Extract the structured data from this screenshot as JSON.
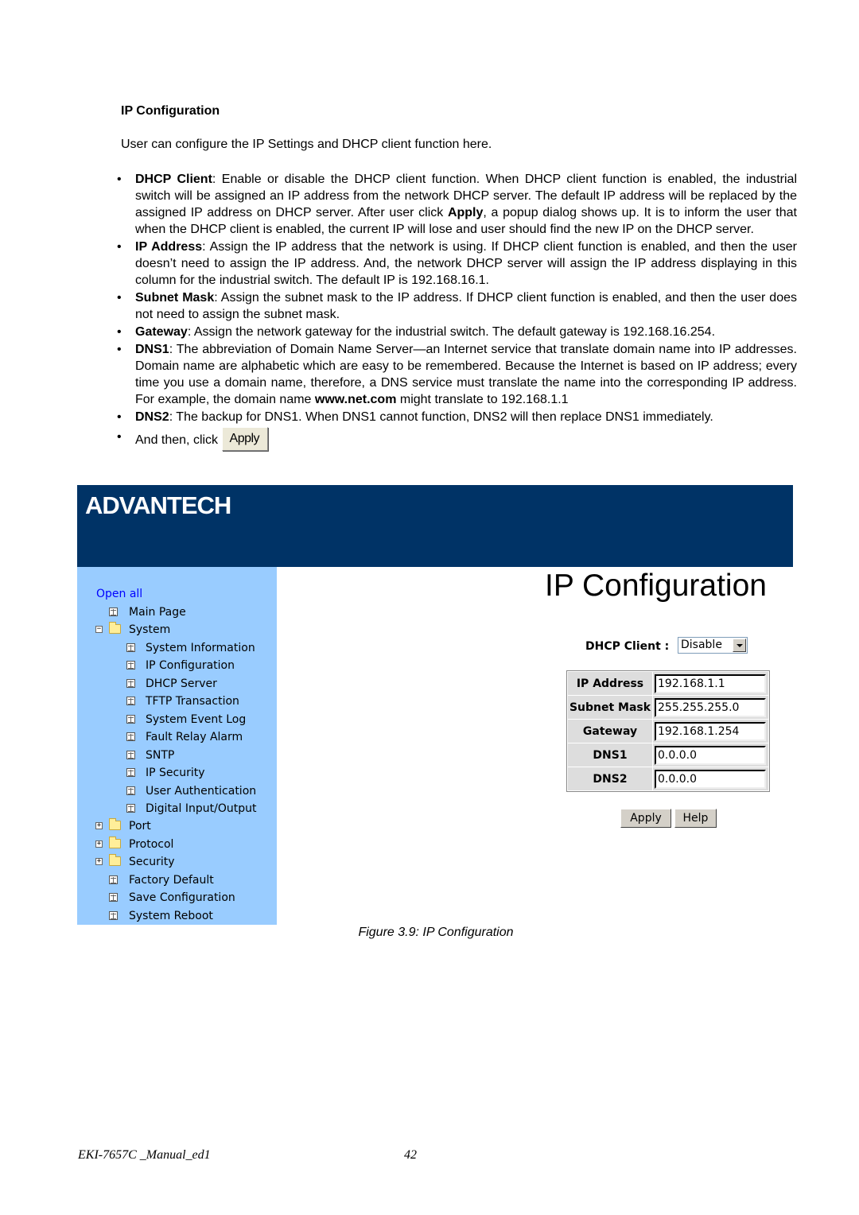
{
  "document": {
    "section_title": "IP Configuration",
    "intro": "User can configure the IP Settings and DHCP client function here.",
    "bullets": [
      {
        "term": "DHCP Client",
        "text_before": ": Enable or disable the DHCP client function. When DHCP client function is enabled, the industrial switch will be assigned an IP address from the network DHCP server. The default IP address will be replaced by the assigned IP address on DHCP server. After user click ",
        "emph": "Apply",
        "text_after": ", a popup dialog shows up. It is to inform the user that when the DHCP client is enabled, the current IP will lose and user should find the new IP on the DHCP server."
      },
      {
        "term": "IP Address",
        "text": ": Assign the IP address that the network is using. If DHCP client function is enabled, and then the user doesn’t need to assign the IP address. And, the network DHCP server will assign the IP address displaying in this column for the industrial switch. The default IP is 192.168.16.1."
      },
      {
        "term": "Subnet Mask",
        "text": ": Assign the subnet mask to the IP address. If DHCP client function is enabled, and then the user does not need to assign the subnet mask."
      },
      {
        "term": "Gateway",
        "text": ": Assign the network gateway for the industrial switch. The default gateway is 192.168.16.254."
      },
      {
        "term": "DNS1",
        "text_before": ": The abbreviation of Domain Name Server—an Internet service that translate domain name into IP addresses. Domain name are alphabetic which are easy to be remembered. Because the Internet is based on IP address; every time you use a domain name, therefore, a DNS service must translate the name into the corresponding IP address. For example, the domain name ",
        "emph": "www.net.com",
        "text_after": " might translate to 192.168.1.1"
      },
      {
        "term": "DNS2",
        "text": ": The backup for DNS1. When DNS1 cannot function, DNS2 will then replace DNS1 immediately."
      }
    ],
    "last_bullet_text": "And then, click",
    "inline_apply_label": "Apply",
    "bullet_glyph": "•",
    "caption": "Figure 3.9: IP Configuration",
    "footer_doc": "EKI-7657C _Manual_ed1",
    "footer_page": "42"
  },
  "screenshot": {
    "logo": "ADVANTECH",
    "colors": {
      "banner": "#003366",
      "sidebar": "#99ccff",
      "open_all_link": "#0000ff"
    },
    "sidebar": {
      "open_all": "Open all",
      "items": [
        {
          "label": "Main Page",
          "type": "page",
          "level": 0
        },
        {
          "label": "System",
          "type": "folder-open",
          "level": 0
        },
        {
          "label": "System Information",
          "type": "page",
          "level": 1
        },
        {
          "label": "IP Configuration",
          "type": "page",
          "level": 1
        },
        {
          "label": "DHCP Server",
          "type": "page",
          "level": 1
        },
        {
          "label": "TFTP Transaction",
          "type": "page",
          "level": 1
        },
        {
          "label": "System Event Log",
          "type": "page",
          "level": 1
        },
        {
          "label": "Fault Relay Alarm",
          "type": "page",
          "level": 1
        },
        {
          "label": "SNTP",
          "type": "page",
          "level": 1
        },
        {
          "label": "IP Security",
          "type": "page",
          "level": 1
        },
        {
          "label": "User Authentication",
          "type": "page",
          "level": 1
        },
        {
          "label": "Digital Input/Output",
          "type": "page",
          "level": 1
        },
        {
          "label": "Port",
          "type": "folder-closed",
          "level": 0
        },
        {
          "label": "Protocol",
          "type": "folder-closed",
          "level": 0
        },
        {
          "label": "Security",
          "type": "folder-closed",
          "level": 0
        },
        {
          "label": "Factory Default",
          "type": "page",
          "level": 0
        },
        {
          "label": "Save Configuration",
          "type": "page",
          "level": 0
        },
        {
          "label": "System Reboot",
          "type": "page",
          "level": 0
        }
      ]
    },
    "main": {
      "heading": "IP Configuration",
      "dhcp_label": "DHCP Client :",
      "dhcp_value": "Disable",
      "fields": [
        {
          "label": "IP Address",
          "value": "192.168.1.1"
        },
        {
          "label": "Subnet Mask",
          "value": "255.255.255.0"
        },
        {
          "label": "Gateway",
          "value": "192.168.1.254"
        },
        {
          "label": "DNS1",
          "value": "0.0.0.0"
        },
        {
          "label": "DNS2",
          "value": "0.0.0.0"
        }
      ],
      "apply_label": "Apply",
      "help_label": "Help"
    }
  }
}
